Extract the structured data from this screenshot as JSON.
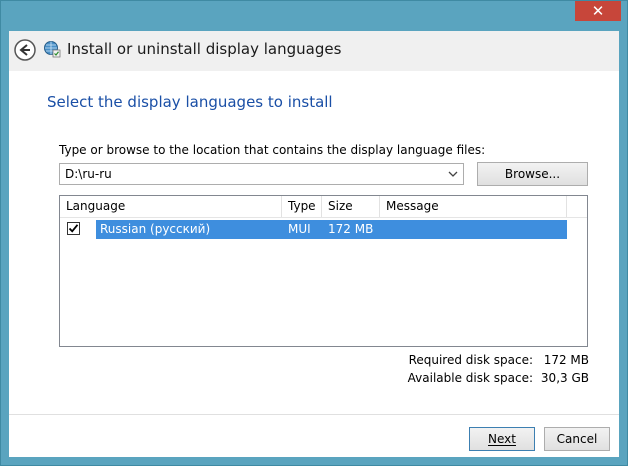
{
  "header": {
    "title": "Install or uninstall display languages"
  },
  "page": {
    "heading": "Select the display languages to install",
    "instruction": "Type or browse to the location that contains the display language files:"
  },
  "path": {
    "value": "D:\\ru-ru"
  },
  "buttons": {
    "browse": "Browse...",
    "next": "Next",
    "cancel": "Cancel"
  },
  "table": {
    "columns": [
      "Language",
      "Type",
      "Size",
      "Message"
    ],
    "rows": [
      {
        "checked": true,
        "language": "Russian (русский)",
        "type": "MUI",
        "size": "172 MB",
        "message": ""
      }
    ]
  },
  "disk": {
    "required_label": "Required disk space:",
    "required_value": "172 MB",
    "available_label": "Available disk space:",
    "available_value": "30,3 GB"
  },
  "colors": {
    "heading": "#1a4fa6",
    "selection": "#3e8ede",
    "close": "#c7463a",
    "frame": "#5aa4bf"
  }
}
